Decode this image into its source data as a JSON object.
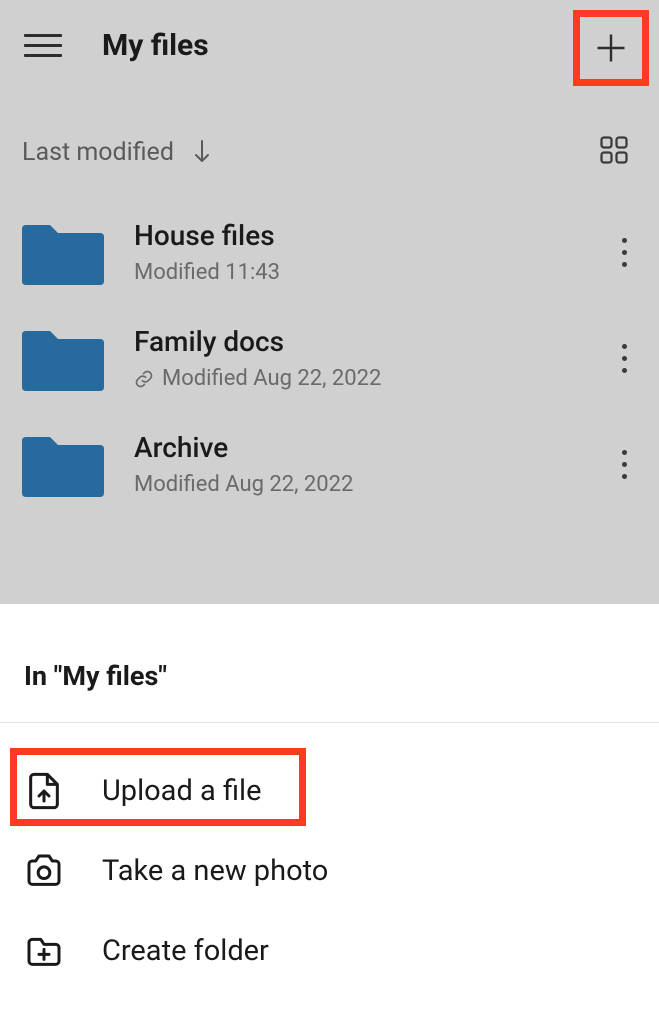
{
  "header": {
    "title": "My files"
  },
  "sort": {
    "label": "Last modified"
  },
  "files": [
    {
      "name": "House files",
      "modified": "Modified 11:43",
      "linked": false
    },
    {
      "name": "Family docs",
      "modified": "Modified Aug 22, 2022",
      "linked": true
    },
    {
      "name": "Archive",
      "modified": "Modified Aug 22, 2022",
      "linked": false
    }
  ],
  "sheet": {
    "title": "In \"My files\"",
    "upload": "Upload a file",
    "photo": "Take a new photo",
    "folder": "Create folder"
  },
  "colors": {
    "folder": "#276b9e",
    "highlight": "#ff3b1f"
  }
}
